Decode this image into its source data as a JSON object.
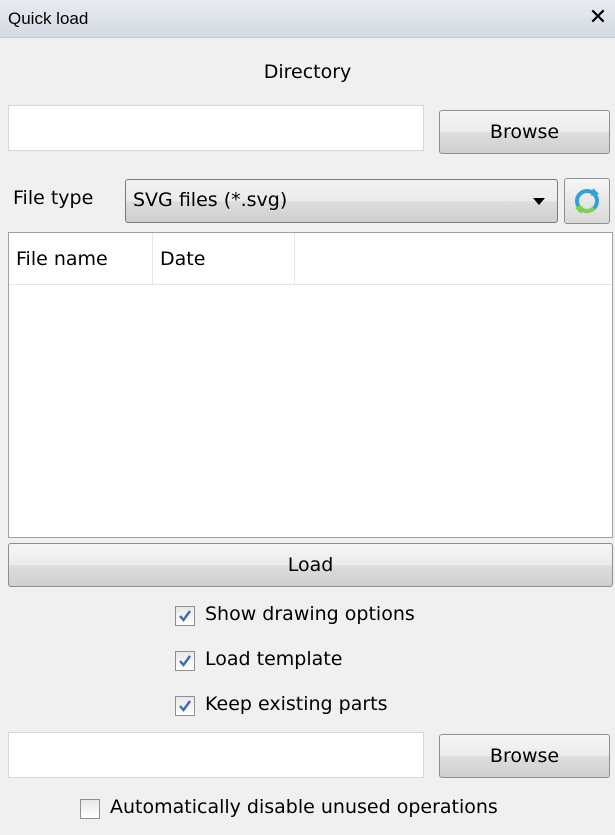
{
  "window": {
    "title": "Quick load",
    "close_glyph": "✕"
  },
  "directory": {
    "label": "Directory",
    "value": "",
    "browse_label": "Browse"
  },
  "file_type": {
    "label": "File type",
    "selected": "SVG files (*.svg)"
  },
  "file_list": {
    "columns": [
      "File name",
      "Date"
    ],
    "rows": []
  },
  "load_button": "Load",
  "options": [
    {
      "label": "Show drawing options",
      "checked": true
    },
    {
      "label": "Load template",
      "checked": true
    },
    {
      "label": "Keep existing parts",
      "checked": true
    }
  ],
  "template": {
    "value": "",
    "browse_label": "Browse"
  },
  "auto_disable": {
    "label": "Automatically disable unused operations",
    "checked": false
  },
  "colors": {
    "checkmark": "#3d6ab3",
    "refresh_icon": "#2fa3d6"
  },
  "icons": [
    "close-icon",
    "chevron-down-icon",
    "refresh-icon",
    "checkmark-icon"
  ]
}
